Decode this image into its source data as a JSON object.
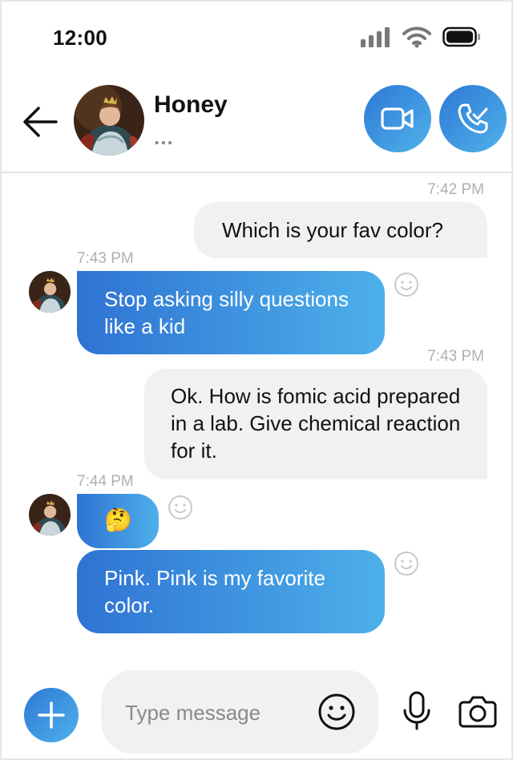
{
  "status_bar": {
    "time": "12:00"
  },
  "header": {
    "name": "Honey",
    "status": "..."
  },
  "messages": [
    {
      "direction": "outgoing",
      "time": "7:42 PM",
      "text": "Which is your fav color?"
    },
    {
      "direction": "incoming",
      "time": "7:43 PM",
      "text": "Stop asking silly questions like a kid"
    },
    {
      "direction": "outgoing",
      "time": "7:43 PM",
      "text": "Ok. How is fomic acid prepared in a lab. Give chemical reaction for it."
    },
    {
      "direction": "incoming",
      "time": "7:44 PM",
      "text": "🤔"
    },
    {
      "direction": "incoming",
      "time": "",
      "text": "Pink. Pink is my favorite color."
    }
  ],
  "composer": {
    "placeholder": "Type message"
  },
  "icons": {
    "back": "arrow-left-icon",
    "video": "video-camera-icon",
    "call": "phone-check-icon",
    "add": "plus-icon",
    "emoji": "smiley-icon",
    "mic": "microphone-icon",
    "camera": "camera-icon"
  },
  "colors": {
    "accent_start": "#2f73d3",
    "accent_end": "#4db0ea",
    "outgoing_bg": "#f1f1f3"
  }
}
